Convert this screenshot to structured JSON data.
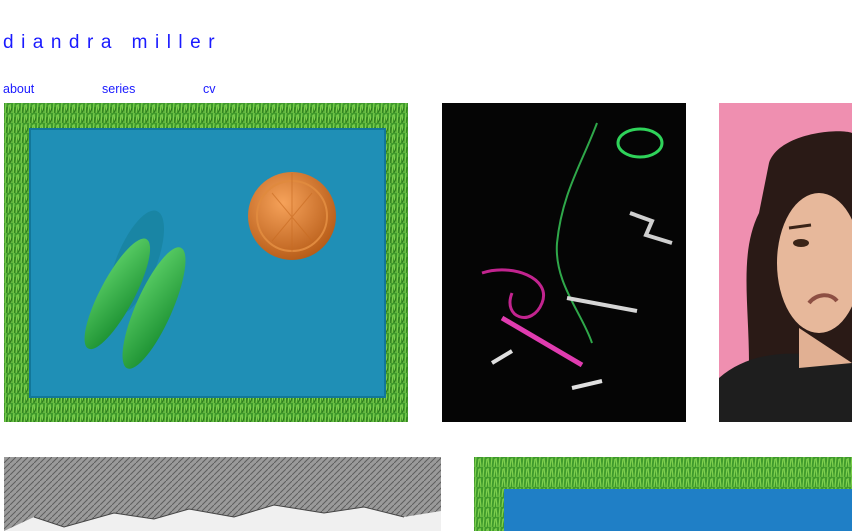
{
  "site": {
    "title": "diandra miller"
  },
  "nav": [
    {
      "label": "about"
    },
    {
      "label": "series"
    },
    {
      "label": "cv"
    }
  ],
  "colors": {
    "link": "#1a1aff",
    "background": "#ffffff"
  },
  "gallery": [
    {
      "name": "toy peas and orange lid on blue board on grass"
    },
    {
      "name": "green, magenta and silver ribbons on black"
    },
    {
      "name": "portrait of a woman frowning on pink"
    },
    {
      "name": "pencil drawing of rocks"
    },
    {
      "name": "blue board on grass"
    }
  ]
}
